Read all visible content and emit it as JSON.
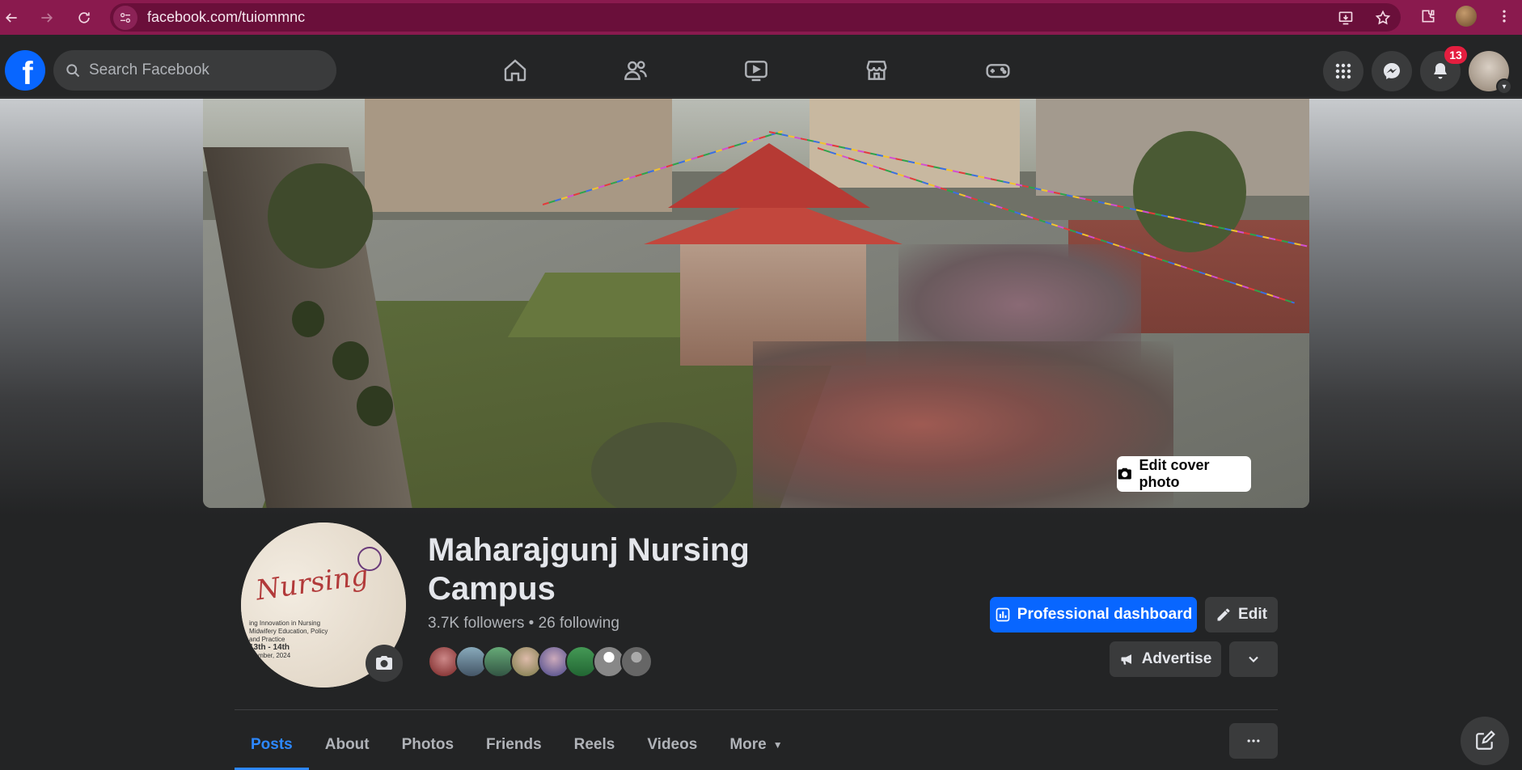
{
  "browser": {
    "url": "facebook.com/tuiommnc",
    "accent": "#8a1a4e"
  },
  "nav": {
    "search_placeholder": "Search Facebook",
    "notifications_count": "13",
    "icons": [
      "home-icon",
      "friends-icon",
      "video-icon",
      "marketplace-icon",
      "gaming-icon"
    ]
  },
  "cover": {
    "edit_label": "Edit cover photo"
  },
  "profile": {
    "name": "Maharajgunj Nursing Campus",
    "followers": "3.7K followers",
    "separator": "•",
    "following": "26 following",
    "picture_text": {
      "title": "Nursing",
      "sub": "ing Innovation in Nursing Midwifery Education, Policy and Practice",
      "dates": "13th - 14th",
      "month": "ptember, 2024"
    }
  },
  "actions": {
    "professional_dashboard": "Professional dashboard",
    "edit": "Edit",
    "advertise": "Advertise"
  },
  "tabs": [
    {
      "label": "Posts",
      "active": true
    },
    {
      "label": "About"
    },
    {
      "label": "Photos"
    },
    {
      "label": "Friends"
    },
    {
      "label": "Reels"
    },
    {
      "label": "Videos"
    },
    {
      "label": "More"
    }
  ],
  "colors": {
    "fb_blue": "#0866ff",
    "active_tab": "#2d88ff",
    "badge_red": "#e41e3f"
  }
}
